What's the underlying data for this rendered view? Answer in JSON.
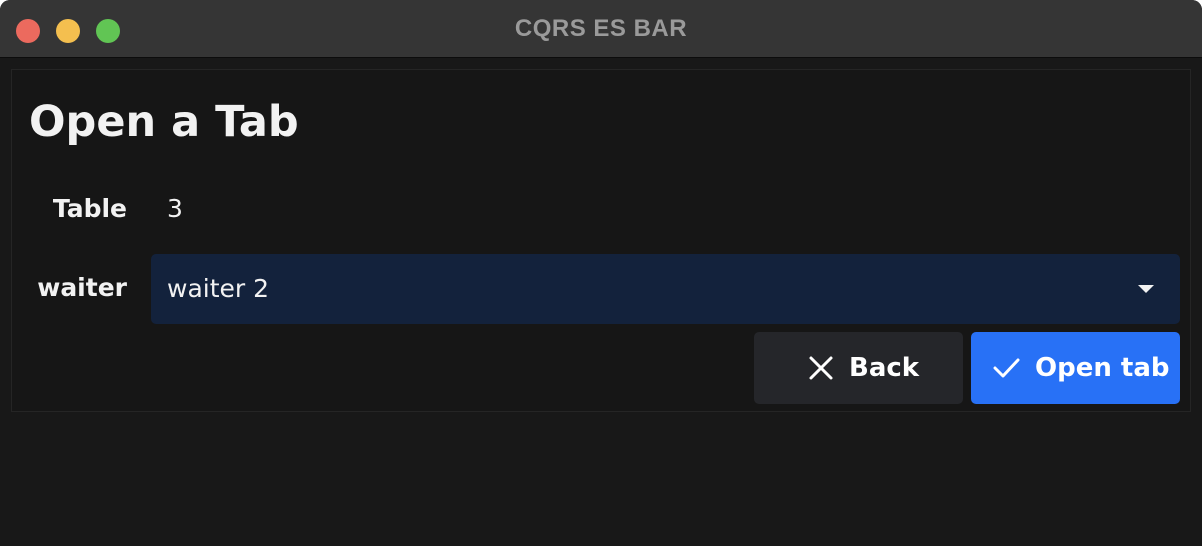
{
  "window": {
    "title": "CQRS ES BAR",
    "controls": {
      "close_color": "#ec6a5e",
      "minimize_color": "#f4bf4f",
      "zoom_color": "#61c554"
    }
  },
  "page": {
    "heading": "Open a Tab"
  },
  "form": {
    "table_label": "Table",
    "table_value": "3",
    "waiter_label": "waiter",
    "waiter_selected": "waiter 2",
    "waiter_dropdown_icon": "chevron-down-icon"
  },
  "actions": {
    "back": {
      "label": "Back",
      "icon": "close-icon"
    },
    "open": {
      "label": "Open tab",
      "icon": "checkmark-icon"
    }
  },
  "colors": {
    "window_background": "#181818",
    "titlebar": "#353535",
    "select_background": "#13223c",
    "back_button": "#25262a",
    "primary_accent": "#2871f6"
  }
}
